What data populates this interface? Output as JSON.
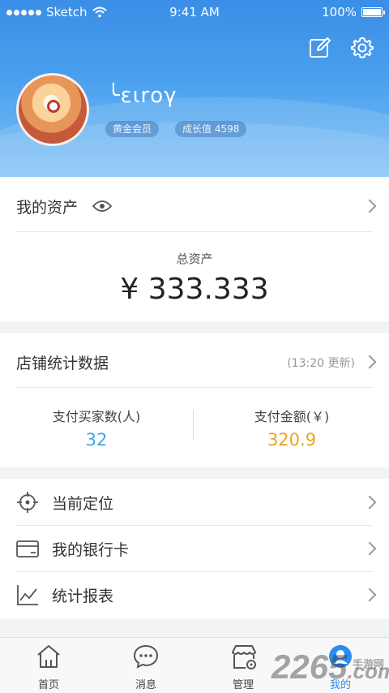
{
  "status_bar": {
    "carrier": "Sketch",
    "time": "9:41 AM",
    "battery": "100%"
  },
  "header": {
    "nickname": "╰ειrογ",
    "member_badge": "黄金会员",
    "growth_badge": "成长值 4598"
  },
  "assets": {
    "title": "我的资产",
    "total_label": "总资产",
    "total_value": "¥ 333.333"
  },
  "store_stats": {
    "title": "店铺统计数据",
    "update_note": "(13:20 更新)",
    "buyers_label": "支付买家数(人)",
    "buyers_value": "32",
    "amount_label": "支付金额(￥)",
    "amount_value": "320.9"
  },
  "menu": [
    {
      "label": "当前定位",
      "icon": "location-crosshair-icon"
    },
    {
      "label": "我的银行卡",
      "icon": "bank-card-icon"
    },
    {
      "label": "统计报表",
      "icon": "line-chart-icon"
    }
  ],
  "tabs": [
    {
      "label": "首页",
      "icon": "home-icon"
    },
    {
      "label": "消息",
      "icon": "message-icon"
    },
    {
      "label": "管理",
      "icon": "store-manage-icon"
    },
    {
      "label": "我的",
      "icon": "profile-icon",
      "active": true
    }
  ],
  "watermark": {
    "number": "2265",
    "site": "手游网",
    "domain": ".com"
  },
  "colors": {
    "primary": "#3a8ee6",
    "buyers": "#3aa8e8",
    "amount": "#f0a21d"
  }
}
